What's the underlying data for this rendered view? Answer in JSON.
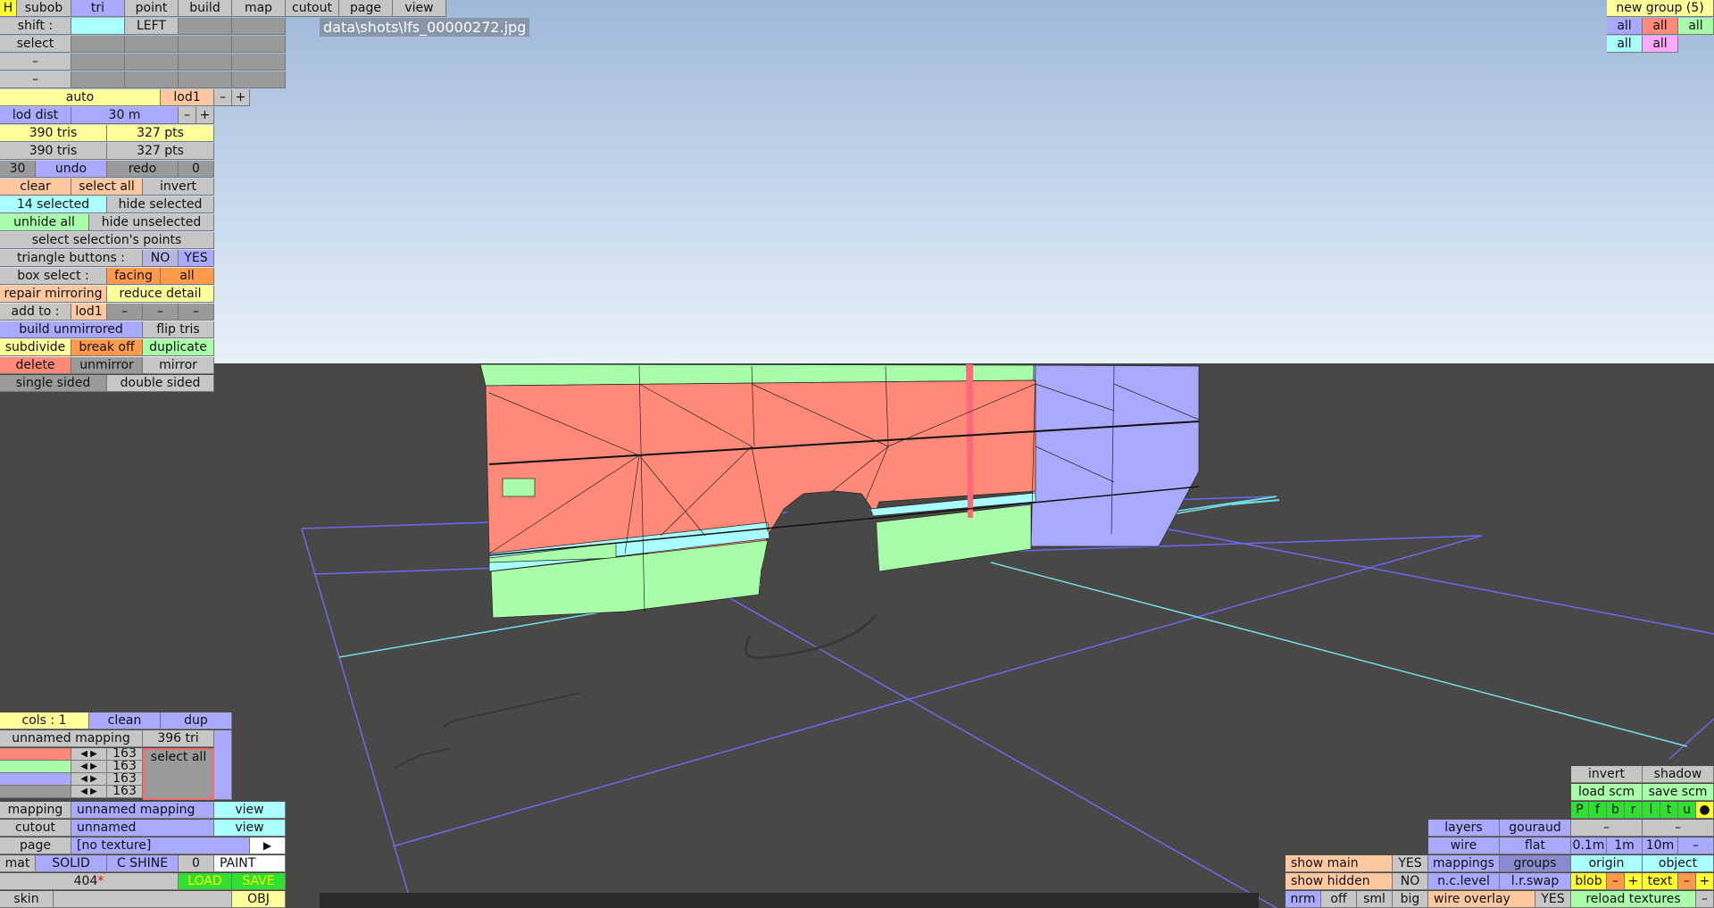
{
  "screenshot_label": "data\\shots\\lfs_00000272.jpg",
  "top_menu": {
    "h": "H",
    "subob": "subob",
    "tri": "tri",
    "point": "point",
    "build": "build",
    "map": "map",
    "cutout": "cutout",
    "page": "page",
    "view": "view"
  },
  "toolbar": {
    "shift_label": "shift :",
    "left": "LEFT",
    "select": "select",
    "dash": "–"
  },
  "lod": {
    "auto": "auto",
    "lod1": "lod1",
    "minus": "–",
    "plus": "+",
    "lod_dist": "lod dist",
    "dist_value": "30 m"
  },
  "stats": {
    "tris1": "390 tris",
    "pts1": "327 pts",
    "tris2": "390 tris",
    "pts2": "327 pts"
  },
  "history": {
    "undo_count": "30",
    "undo": "undo",
    "redo": "redo",
    "redo_count": "0"
  },
  "selection": {
    "clear": "clear",
    "select_all": "select all",
    "invert": "invert",
    "selected": "14 selected",
    "hide_selected": "hide selected",
    "unhide_all": "unhide all",
    "hide_unselected": "hide unselected",
    "select_points": "select selection's points",
    "triangle_buttons": "triangle buttons :",
    "no": "NO",
    "yes": "YES",
    "box_select": "box select :",
    "facing": "facing",
    "all": "all",
    "repair_mirroring": "repair mirroring",
    "reduce_detail": "reduce detail",
    "add_to": "add to :",
    "add_lod1": "lod1",
    "build_unmirrored": "build unmirrored",
    "flip_tris": "flip tris",
    "subdivide": "subdivide",
    "break_off": "break off",
    "duplicate": "duplicate",
    "delete": "delete",
    "unmirror": "unmirror",
    "mirror": "mirror",
    "single_sided": "single sided",
    "double_sided": "double sided"
  },
  "groups": {
    "new_group": "new group (5)",
    "all": "all"
  },
  "mapping_panel": {
    "cols": "cols : 1",
    "clean": "clean",
    "dup": "dup",
    "unnamed_mapping": "unnamed mapping",
    "tri_count": "396 tri",
    "col_value": "163",
    "select_all": "select all",
    "mapping": "mapping",
    "mapping_value": "unnamed mapping",
    "view": "view",
    "cutout": "cutout",
    "cutout_value": "unnamed",
    "page": "page",
    "page_value": "[no texture]",
    "mat": "mat",
    "solid": "SOLID",
    "cshine": "C SHINE",
    "zero": "0",
    "paint": "PAINT",
    "num": "404",
    "star": "*",
    "load": "LOAD",
    "save": "SAVE",
    "skin": "skin",
    "obj": "OBJ"
  },
  "view_panel": {
    "invert": "invert",
    "shadow": "shadow",
    "load_scm": "load scm",
    "save_scm": "save scm",
    "letters": [
      "P",
      "f",
      "b",
      "r",
      "l",
      "t",
      "u"
    ],
    "layers": "layers",
    "gouraud": "gouraud",
    "wire": "wire",
    "flat": "flat",
    "dist1": "0.1m",
    "dist2": "1m",
    "dist3": "10m",
    "mappings": "mappings",
    "groups": "groups",
    "origin": "origin",
    "object": "object",
    "nclevel": "n.c.level",
    "lrswap": "l.r.swap",
    "blob": "blob",
    "text": "text",
    "show_main": "show main",
    "show_hidden": "show hidden",
    "yes": "YES",
    "no": "NO",
    "nrm": "nrm",
    "off": "off",
    "sml": "sml",
    "big": "big",
    "wire_overlay": "wire overlay",
    "reload_textures": "reload textures"
  },
  "colors": {
    "red": "#ff8a7a",
    "green": "#a9ffa9",
    "blue": "#a9a9ff",
    "cyan": "#a9ffff"
  }
}
